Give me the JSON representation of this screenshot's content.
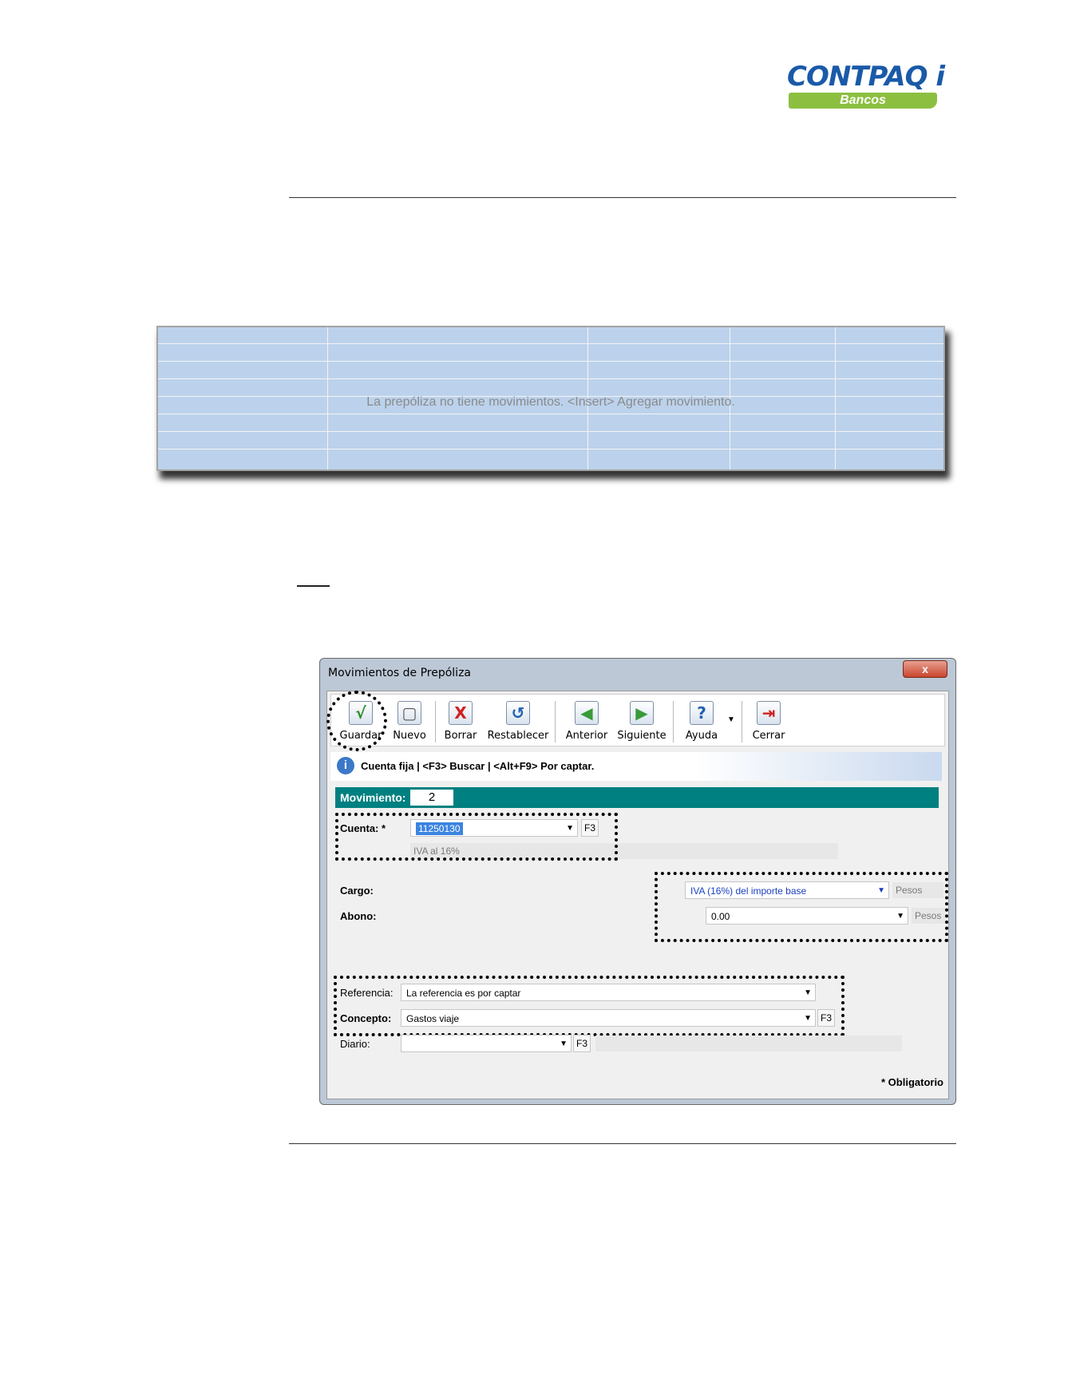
{
  "logo": {
    "name": "CONTPAQ i",
    "product": "Bancos"
  },
  "grid": {
    "empty_message": "La prepóliza no tiene movimientos. <Insert> Agregar movimiento."
  },
  "window": {
    "title": "Movimientos de Prepóliza",
    "close_label": "x",
    "toolbar": [
      {
        "label": "Guardar",
        "icon": "check-icon",
        "glyph": "√",
        "color": "#2a8a2a"
      },
      {
        "label": "Nuevo",
        "icon": "new-document-icon",
        "glyph": "▢",
        "color": "#555555"
      },
      {
        "label": "Borrar",
        "icon": "delete-x-icon",
        "glyph": "X",
        "color": "#d02020"
      },
      {
        "label": "Restablecer",
        "icon": "undo-icon",
        "glyph": "↺",
        "color": "#2060b0"
      },
      {
        "label": "Anterior",
        "icon": "previous-arrow-icon",
        "glyph": "◀",
        "color": "#3a9a3a"
      },
      {
        "label": "Siguiente",
        "icon": "next-arrow-icon",
        "glyph": "▶",
        "color": "#3a9a3a"
      },
      {
        "label": "Ayuda",
        "icon": "help-icon",
        "glyph": "?",
        "color": "#2060b0"
      },
      {
        "label": "Cerrar",
        "icon": "exit-icon",
        "glyph": "⇥",
        "color": "#d02020"
      }
    ],
    "info": "Cuenta fija | <F3> Buscar | <Alt+F9> Por captar.",
    "movimiento": {
      "label": "Movimiento:",
      "value": "2"
    },
    "cuenta": {
      "label": "Cuenta: *",
      "value": "11250130",
      "description": "IVA al 16%",
      "f3": "F3"
    },
    "cargo": {
      "label": "Cargo:",
      "value": "IVA (16%) del importe base",
      "currency": "Pesos"
    },
    "abono": {
      "label": "Abono:",
      "value": "0.00",
      "currency": "Pesos"
    },
    "referencia": {
      "label": "Referencia:",
      "value": "La referencia es por captar"
    },
    "concepto": {
      "label": "Concepto:",
      "value": "Gastos viaje",
      "f3": "F3"
    },
    "diario": {
      "label": "Diario:",
      "value": "",
      "f3": "F3"
    },
    "footer": "* Obligatorio"
  }
}
